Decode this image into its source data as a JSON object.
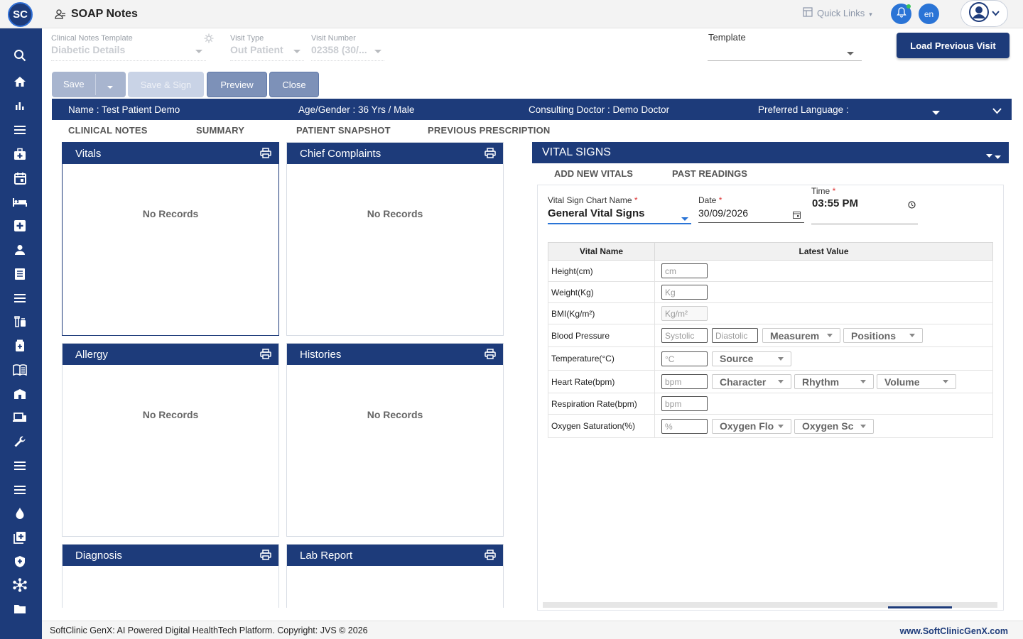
{
  "app": {
    "logo_text": "SC",
    "title": "SOAP Notes",
    "quick_links": "Quick Links",
    "lang": "en"
  },
  "sidebar": {
    "items": [
      {
        "icon": "search-icon"
      },
      {
        "icon": "home-icon"
      },
      {
        "icon": "bar-chart-icon"
      },
      {
        "icon": "menu-icon"
      },
      {
        "icon": "medical-bag-icon"
      },
      {
        "icon": "calendar-icon"
      },
      {
        "icon": "bed-icon"
      },
      {
        "icon": "medical-plus-icon"
      },
      {
        "icon": "user-icon"
      },
      {
        "icon": "document-icon"
      },
      {
        "icon": "list-icon"
      },
      {
        "icon": "pharmacy-icon"
      },
      {
        "icon": "vial-icon"
      },
      {
        "icon": "book-icon"
      },
      {
        "icon": "hospital-icon"
      },
      {
        "icon": "devices-icon"
      },
      {
        "icon": "wrench-icon"
      },
      {
        "icon": "list-icon"
      },
      {
        "icon": "menu-icon"
      },
      {
        "icon": "blood-drop-icon"
      },
      {
        "icon": "add-box-icon"
      },
      {
        "icon": "shield-icon"
      },
      {
        "icon": "network-icon"
      },
      {
        "icon": "folder-icon"
      }
    ]
  },
  "form": {
    "clinical_template_label": "Clinical Notes Template",
    "clinical_template_value": "Diabetic Details",
    "visit_type_label": "Visit Type",
    "visit_type_value": "Out Patient",
    "visit_number_label": "Visit Number",
    "visit_number_value": "02358 (30/...",
    "template_label": "Template",
    "load_previous": "Load Previous Visit"
  },
  "actions": {
    "save": "Save",
    "save_sign": "Save & Sign",
    "preview": "Preview",
    "close": "Close"
  },
  "patient": {
    "name": "Name :  Test Patient Demo",
    "age_gender": "Age/Gender :  36 Yrs / Male",
    "doctor": "Consulting Doctor :  Demo Doctor",
    "language": "Preferred Language :"
  },
  "tabs": [
    "CLINICAL NOTES",
    "SUMMARY",
    "PATIENT SNAPSHOT",
    "PREVIOUS PRESCRIPTION"
  ],
  "cards": {
    "vitals": "Vitals",
    "chief_complaints": "Chief Complaints",
    "allergy": "Allergy",
    "histories": "Histories",
    "diagnosis": "Diagnosis",
    "lab_report": "Lab Report",
    "no_records": "No Records"
  },
  "vital_signs": {
    "title": "VITAL SIGNS",
    "tab_add": "ADD NEW VITALS",
    "tab_past": "PAST READINGS",
    "chart_name_label": "Vital Sign Chart Name",
    "chart_name_value": "General Vital Signs",
    "date_label": "Date",
    "date_value": "30/09/2026",
    "time_label": "Time",
    "time_value": "03:55  PM",
    "required_mark": "*",
    "col_name": "Vital Name",
    "col_value": "Latest Value",
    "rows": {
      "height": {
        "name": "Height(cm)",
        "ph": "cm"
      },
      "weight": {
        "name": "Weight(Kg)",
        "ph": "Kg"
      },
      "bmi": {
        "name": "BMI(Kg/m²)",
        "ph": "Kg/m²"
      },
      "bp": {
        "name": "Blood Pressure",
        "ph1": "Systolic",
        "ph2": "Diastolic",
        "sel1": "Measurem",
        "sel2": "Positions"
      },
      "temp": {
        "name": "Temperature(°C)",
        "ph": "°C",
        "sel1": "Source"
      },
      "hr": {
        "name": "Heart Rate(bpm)",
        "ph": "bpm",
        "sel1": "Character",
        "sel2": "Rhythm",
        "sel3": "Volume"
      },
      "rr": {
        "name": "Respiration Rate(bpm)",
        "ph": "bpm"
      },
      "spo2": {
        "name": "Oxygen Saturation(%)",
        "ph": "%",
        "sel1": "Oxygen Flo",
        "sel2": "Oxygen Sc"
      }
    }
  },
  "footer": {
    "left": "SoftClinic GenX: AI Powered Digital HealthTech Platform. Copyright: JVS © 2026",
    "right": "www.SoftClinicGenX.com"
  },
  "colors": {
    "primary": "#1d3b7a",
    "accent": "#2a74d6"
  }
}
